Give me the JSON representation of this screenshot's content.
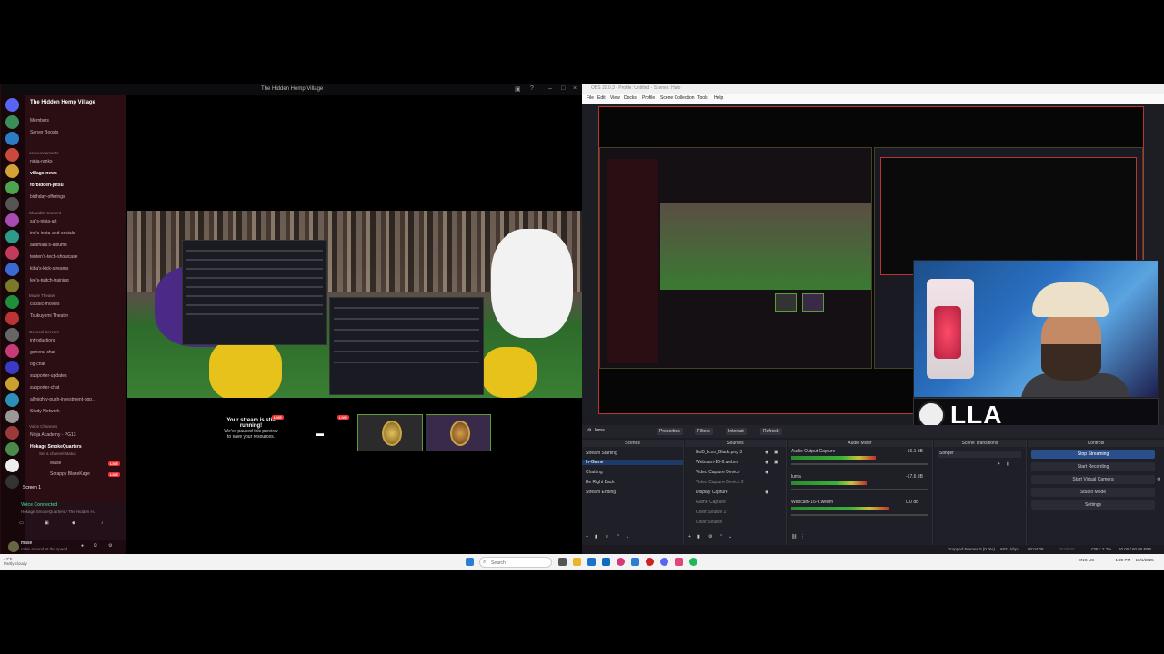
{
  "discord": {
    "window_title": "The Hidden Hemp Village",
    "server_name": "The Hidden Hemp Village",
    "top_items": [
      "Members",
      "Server Boosts"
    ],
    "categories": [
      {
        "name": "Announcements",
        "channels": [
          "ninja-ranks",
          "village-news",
          "forbidden-jutsu",
          "birthday-offerings"
        ]
      },
      {
        "name": "Sharable Content",
        "channels": [
          "sai's-ninja-art",
          "ino's-insta-and-socials",
          "akamaru's-albums",
          "tenten's-tech-showcase",
          "kiba's-kick-streams",
          "lee's-twitch-training"
        ]
      },
      {
        "name": "Movie Theater",
        "channels": [
          "classic-movies",
          "Tsukuyomi Theater"
        ]
      },
      {
        "name": "General Servers",
        "channels": [
          "introductions",
          "general-chat",
          "og-chat",
          "supporter-updates",
          "supporter-chat",
          "allmighty-push-investment-opp...",
          "Study Network"
        ]
      },
      {
        "name": "Voice Channels",
        "channels": [
          "Ninja Academy - PG13",
          "Hokage SmokeQuarters"
        ]
      }
    ],
    "voice_channel_status": "Set a channel status",
    "voice_members": [
      "Mase",
      "Scrappy BlazeKage"
    ],
    "live_badge": "LIVE",
    "screen_share_label": "Screen 1",
    "voice_connected": {
      "title": "Voice Connected",
      "subtitle": "Hokage SmokeQuarters / The Hidden H..."
    },
    "user": {
      "name": "mase",
      "status": "roller around at the speed..."
    },
    "stream_message": {
      "title": "Your stream is still running!",
      "body": "We've paused this preview to save your resources."
    }
  },
  "obs": {
    "window_title": "OBS 32.0.3 - Profile: Untitled - Scenes: Halo",
    "menu": [
      "File",
      "Edit",
      "View",
      "Docks",
      "Profile",
      "Scene Collection",
      "Tools",
      "Help"
    ],
    "source_bar": {
      "selected": "luma",
      "buttons": [
        "Properties",
        "Filters",
        "Interact",
        "Refresh"
      ]
    },
    "docks": {
      "scenes": {
        "title": "Scenes",
        "items": [
          "Stream Starting",
          "In-Game",
          "Chatting",
          "Be Right Back",
          "Stream Ending"
        ],
        "selected": "In-Game"
      },
      "sources": {
        "title": "Sources",
        "items": [
          "NoD_Icon_Black.png 3",
          "Webcam-16-9.webm",
          "Video Capture Device",
          "Video Capture Device 2",
          "Display Capture",
          "Game Capture",
          "Color Source 2",
          "Color Source"
        ]
      },
      "audio_mixer": {
        "title": "Audio Mixer",
        "channels": [
          {
            "name": "Audio Output Capture",
            "db": "-16.1 dB",
            "level": 0.62
          },
          {
            "name": "luma",
            "db": "-17.6 dB",
            "level": 0.55
          },
          {
            "name": "Webcam-16-9.webm",
            "db": "0.0 dB",
            "level": 0.72
          }
        ]
      },
      "transitions": {
        "title": "Scene Transitions",
        "current": "Stinger"
      },
      "controls": {
        "title": "Controls",
        "buttons": [
          "Stop Streaming",
          "Start Recording",
          "Start Virtual Camera",
          "Studio Mode",
          "Settings"
        ]
      }
    },
    "status": {
      "dropped": "Dropped Frames 0 (0.0%)",
      "bitrate": "6831 kbps",
      "stream_time": "00:04:08",
      "rec_time": "00:00:00",
      "cpu": "CPU: 2.7%",
      "fps": "60.00 / 60.00 FPS"
    },
    "overlay_text": "LLA"
  },
  "taskbar": {
    "weather_temp": "43°F",
    "weather_desc": "Partly cloudy",
    "search_placeholder": "Search",
    "time": "1:20 PM",
    "date": "10/1/2025",
    "lang": "ENG US"
  }
}
